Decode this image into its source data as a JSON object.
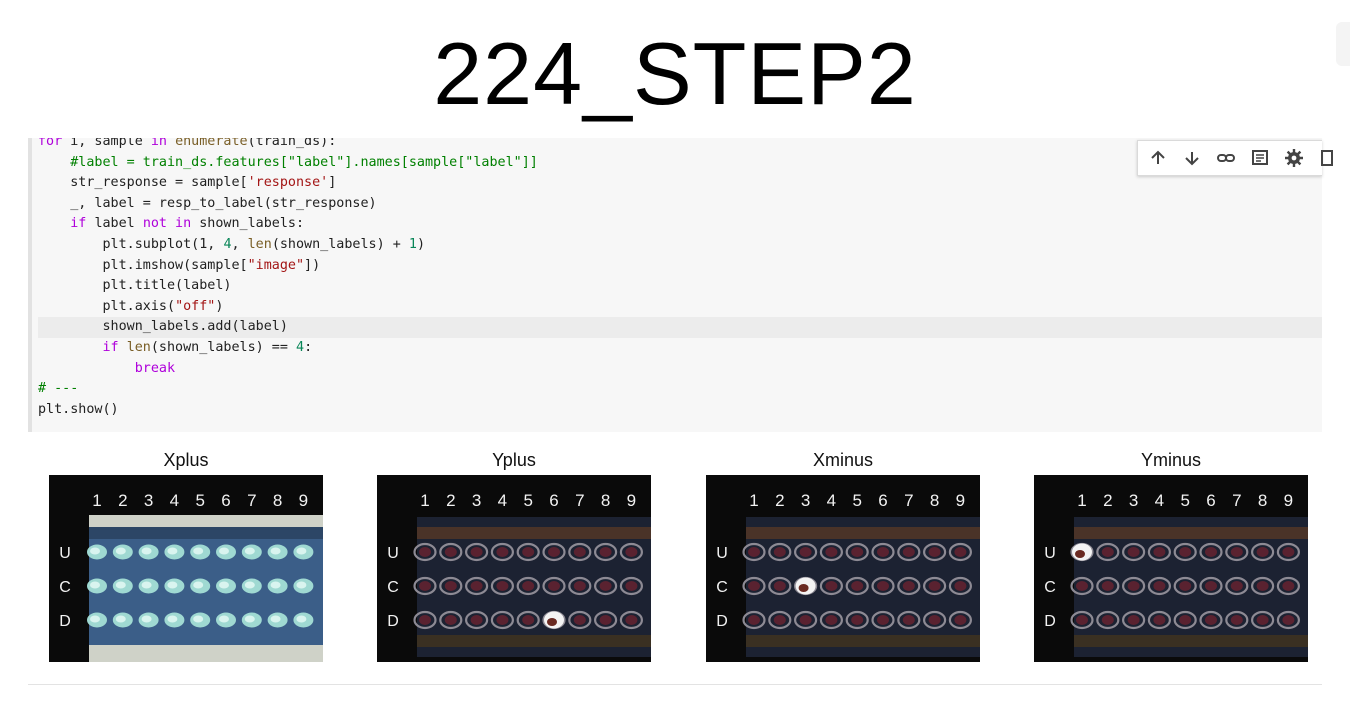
{
  "slide": {
    "title": "224_STEP2"
  },
  "code_lines": [
    [
      {
        "t": "for ",
        "c": "kw"
      },
      {
        "t": "i, sample "
      },
      {
        "t": "in ",
        "c": "kw"
      },
      {
        "t": "enumerate",
        "c": "bi"
      },
      {
        "t": "(train_ds):"
      }
    ],
    [
      {
        "t": "    "
      },
      {
        "t": "#label = train_ds.features[\"label\"].names[sample[\"label\"]]",
        "c": "cm"
      }
    ],
    [
      {
        "t": "    str_response = sample["
      },
      {
        "t": "'response'",
        "c": "str"
      },
      {
        "t": "]"
      }
    ],
    [
      {
        "t": "    _, label = resp_to_label(str_response)"
      }
    ],
    [
      {
        "t": "    "
      },
      {
        "t": "if ",
        "c": "kw"
      },
      {
        "t": "label "
      },
      {
        "t": "not in ",
        "c": "kw"
      },
      {
        "t": "shown_labels:"
      }
    ],
    [
      {
        "t": "        plt.subplot(1, "
      },
      {
        "t": "4",
        "c": "num"
      },
      {
        "t": ", "
      },
      {
        "t": "len",
        "c": "bi"
      },
      {
        "t": "(shown_labels) + "
      },
      {
        "t": "1",
        "c": "num"
      },
      {
        "t": ")"
      }
    ],
    [
      {
        "t": "        plt.imshow(sample["
      },
      {
        "t": "\"image\"",
        "c": "str"
      },
      {
        "t": "])"
      }
    ],
    [
      {
        "t": "        plt.title(label)"
      }
    ],
    [
      {
        "t": "        plt.axis("
      },
      {
        "t": "\"off\"",
        "c": "str"
      },
      {
        "t": ")"
      }
    ],
    [
      {
        "t": "        shown_labels.add(label)"
      }
    ],
    [
      {
        "t": "        "
      },
      {
        "t": "if ",
        "c": "kw"
      },
      {
        "t": "len",
        "c": "bi"
      },
      {
        "t": "(shown_labels) == "
      },
      {
        "t": "4",
        "c": "num"
      },
      {
        "t": ":"
      }
    ],
    [
      {
        "t": "            "
      },
      {
        "t": "break",
        "c": "kw"
      }
    ],
    [
      {
        "t": "# ---",
        "c": "cm"
      }
    ],
    [
      {
        "t": "plt.show()"
      }
    ]
  ],
  "toolbar": {
    "icons": [
      "arrow-up-icon",
      "arrow-down-icon",
      "link-icon",
      "comment-icon",
      "gear-icon",
      "copy-icon"
    ]
  },
  "panels": [
    {
      "title": "Xplus",
      "columns": [
        "1",
        "2",
        "3",
        "4",
        "5",
        "6",
        "7",
        "8",
        "9"
      ],
      "rows": [
        "U",
        "C",
        "D"
      ],
      "style": "bright"
    },
    {
      "title": "Yplus",
      "columns": [
        "1",
        "2",
        "3",
        "4",
        "5",
        "6",
        "7",
        "8",
        "9"
      ],
      "rows": [
        "U",
        "C",
        "D"
      ],
      "style": "dark",
      "highlight": {
        "row": 2,
        "col": 5
      }
    },
    {
      "title": "Xminus",
      "columns": [
        "1",
        "2",
        "3",
        "4",
        "5",
        "6",
        "7",
        "8",
        "9"
      ],
      "rows": [
        "U",
        "C",
        "D"
      ],
      "style": "dark",
      "highlight": {
        "row": 1,
        "col": 2
      }
    },
    {
      "title": "Yminus",
      "columns": [
        "1",
        "2",
        "3",
        "4",
        "5",
        "6",
        "7",
        "8",
        "9"
      ],
      "rows": [
        "U",
        "C",
        "D"
      ],
      "style": "dark",
      "highlight": {
        "row": 0,
        "col": 0
      }
    }
  ],
  "colors": {
    "keyword": "#af00db",
    "string": "#a31515",
    "number": "#098658",
    "comment": "#008000",
    "builtin": "#795e26",
    "panel_bg": "#0b0b0b",
    "tray_blue": "#3d5f86"
  }
}
